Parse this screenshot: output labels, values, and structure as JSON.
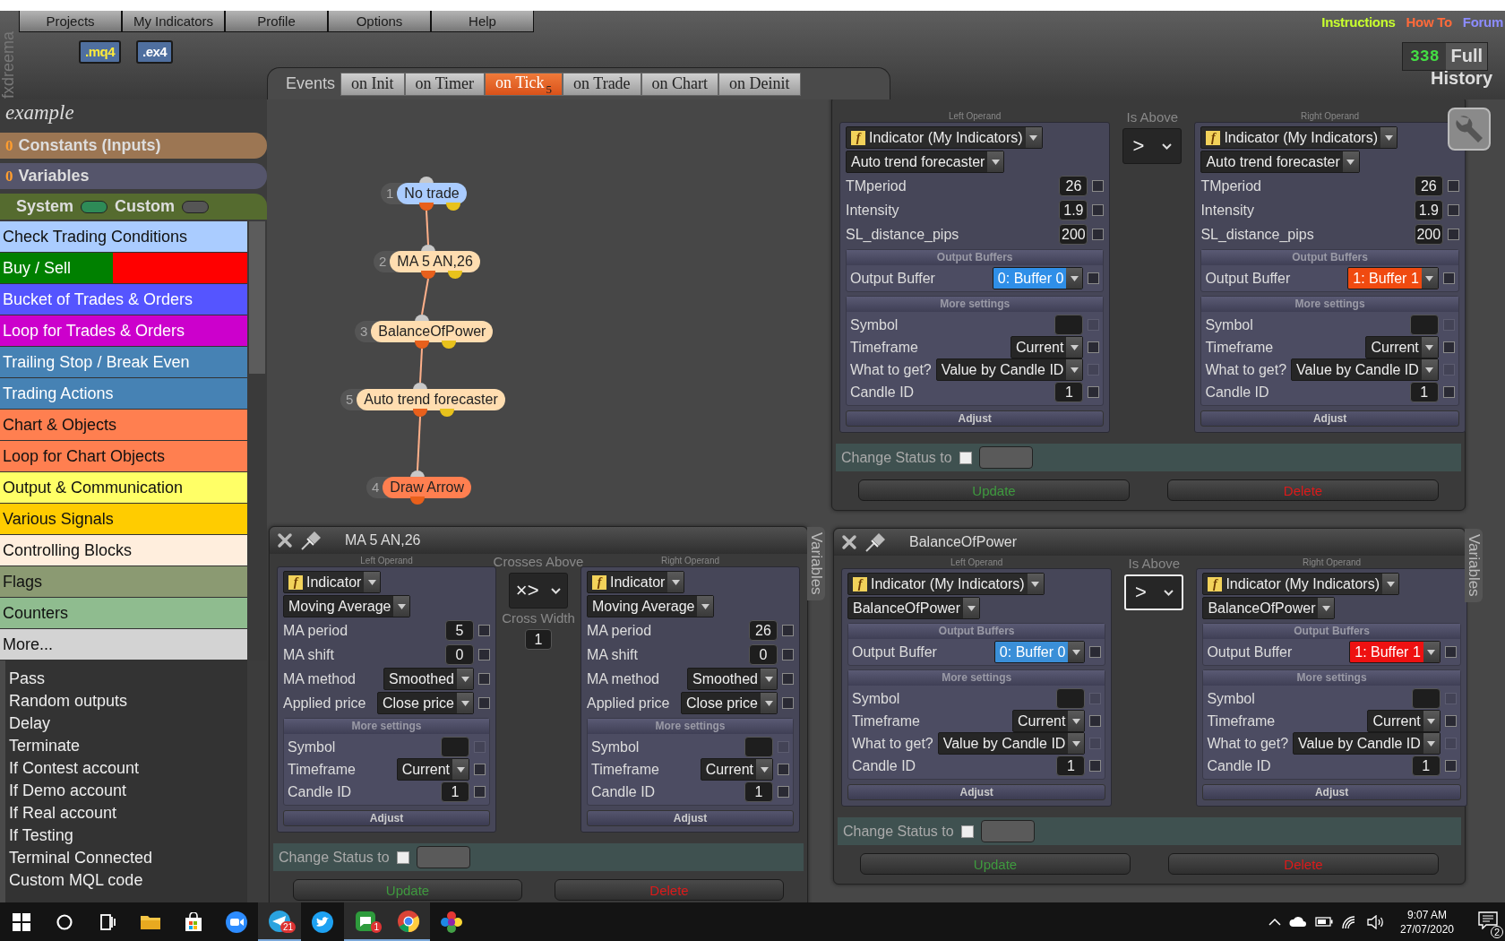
{
  "header": {
    "brand": "fxdreema",
    "menu": [
      {
        "label": "Projects"
      },
      {
        "label": "My Indicators"
      },
      {
        "label": "Profile"
      },
      {
        "label": "Options"
      },
      {
        "label": "Help"
      }
    ],
    "file_buttons": [
      ".mq4",
      ".ex4"
    ],
    "links": [
      {
        "label": "Instructions",
        "color": "#c8ff2e"
      },
      {
        "label": "How To",
        "color": "#ff6a3a"
      },
      {
        "label": "Forum",
        "color": "#8c8cff"
      }
    ],
    "counter": {
      "value": "338",
      "label": "Full"
    },
    "history": "History",
    "events": {
      "label": "Events",
      "tabs": [
        {
          "label": "on Init",
          "selected": false
        },
        {
          "label": "on Timer",
          "selected": false
        },
        {
          "label": "on Tick",
          "badge": "5",
          "selected": true
        },
        {
          "label": "on Trade",
          "selected": false
        },
        {
          "label": "on Chart",
          "selected": false
        },
        {
          "label": "on Deinit",
          "selected": false
        }
      ]
    }
  },
  "sidebar": {
    "project": "example",
    "constants": {
      "count": "0",
      "label": "Constants (Inputs)"
    },
    "variables": {
      "count": "0",
      "label": "Variables"
    },
    "toggles": [
      {
        "label": "System",
        "on": true
      },
      {
        "label": "Custom",
        "on": false
      }
    ],
    "categories": [
      {
        "label": "Check Trading Conditions",
        "color": "#aaccff"
      },
      {
        "label": "Buy / Sell",
        "color": "#008000",
        "split": {
          "color": "#ff0000"
        }
      },
      {
        "label": "Bucket of Trades & Orders",
        "color": "#5555ff"
      },
      {
        "label": "Loop for Trades & Orders",
        "color": "#cc00cc"
      },
      {
        "label": "Trailing Stop / Break Even",
        "color": "#4682b4"
      },
      {
        "label": "Trading Actions",
        "color": "#4682b4"
      },
      {
        "label": "Chart & Objects",
        "color": "#ff7f50"
      },
      {
        "label": "Loop for Chart Objects",
        "color": "#ff7f50"
      },
      {
        "label": "Output & Communication",
        "color": "#ffff66"
      },
      {
        "label": "Various Signals",
        "color": "#ffcc00"
      },
      {
        "label": "Controlling Blocks",
        "color": "#ffeedd"
      },
      {
        "label": "Flags",
        "color": "#8b9a72"
      },
      {
        "label": "Counters",
        "color": "#8fbc8f"
      },
      {
        "label": "More...",
        "color": "#d3d3d3"
      }
    ],
    "more_items": [
      "Pass",
      "Random outputs",
      "Delay",
      "Terminate",
      "If Contest account",
      "If Demo account",
      "If Real account",
      "If Testing",
      "Terminal Connected",
      "Custom MQL code"
    ]
  },
  "nodes": [
    {
      "number": "1",
      "label": "No trade",
      "color": "#aaccff",
      "kind": "condition"
    },
    {
      "number": "2",
      "label": "MA 5 AN,26",
      "color": "#ffddb0",
      "kind": "condition"
    },
    {
      "number": "3",
      "label": "BalanceOfPower",
      "color": "#ffddb0",
      "kind": "condition"
    },
    {
      "number": "5",
      "label": "Auto trend forecaster",
      "color": "#ffddb0",
      "kind": "condition"
    },
    {
      "number": "4",
      "label": "Draw Arrow",
      "color": "#ff7f50",
      "kind": "action"
    }
  ],
  "panels": [
    {
      "left": {
        "header": "Left Operand",
        "type": {
          "icon": "f",
          "label": "Indicator (My Indicators)"
        },
        "indicator": "Auto trend forecaster",
        "params": [
          {
            "label": "TMperiod",
            "value": "26",
            "kind": "number",
            "checked": false,
            "disabled": false
          },
          {
            "label": "Intensity",
            "value": "1.9",
            "kind": "number",
            "checked": false,
            "disabled": false
          },
          {
            "label": "SL_distance_pips",
            "value": "200",
            "kind": "number",
            "checked": false,
            "disabled": false
          }
        ],
        "output": {
          "header": "Output Buffers",
          "label": "Output Buffer",
          "value": "0: Buffer 0",
          "color": "#2f8fe8",
          "checked": false,
          "disabled": false
        },
        "more": {
          "header": "More settings",
          "rows": [
            {
              "label": "Symbol",
              "kind": "number",
              "checked": false,
              "disabled": true
            },
            {
              "label": "Timeframe",
              "value": "Current",
              "kind": "select",
              "checked": false,
              "disabled": false
            },
            {
              "label": "What to get?",
              "value": "Value by Candle ID",
              "kind": "select",
              "checked": false,
              "disabled": true
            },
            {
              "label": "Candle ID",
              "value": "1",
              "kind": "number",
              "checked": false,
              "disabled": false
            }
          ]
        },
        "adjust": "Adjust"
      },
      "operator": {
        "label": "Is Above",
        "symbol": ">",
        "focused": false
      },
      "right": {
        "header": "Right Operand",
        "type": {
          "icon": "f",
          "label": "Indicator (My Indicators)"
        },
        "indicator": "Auto trend forecaster",
        "params": [
          {
            "label": "TMperiod",
            "value": "26",
            "kind": "number",
            "checked": false,
            "disabled": false
          },
          {
            "label": "Intensity",
            "value": "1.9",
            "kind": "number",
            "checked": false,
            "disabled": false
          },
          {
            "label": "SL_distance_pips",
            "value": "200",
            "kind": "number",
            "checked": false,
            "disabled": false
          }
        ],
        "output": {
          "header": "Output Buffers",
          "label": "Output Buffer",
          "value": "1: Buffer 1",
          "color": "#f04a10",
          "checked": false,
          "disabled": false
        },
        "more": {
          "header": "More settings",
          "rows": [
            {
              "label": "Symbol",
              "kind": "number",
              "checked": false,
              "disabled": true
            },
            {
              "label": "Timeframe",
              "value": "Current",
              "kind": "select",
              "checked": false,
              "disabled": false
            },
            {
              "label": "What to get?",
              "value": "Value by Candle ID",
              "kind": "select",
              "checked": false,
              "disabled": true
            },
            {
              "label": "Candle ID",
              "value": "1",
              "kind": "number",
              "checked": false,
              "disabled": false
            }
          ]
        },
        "adjust": "Adjust"
      },
      "status": {
        "label": "Change Status to",
        "checked": false
      },
      "buttons": [
        {
          "label": "Update",
          "kind": "update"
        },
        {
          "label": "Delete",
          "kind": "delete"
        }
      ]
    },
    {
      "title": "MA 5 AN,26",
      "side_tab": "Variables",
      "left": {
        "header": "Left Operand",
        "type": {
          "icon": "f",
          "label": "Indicator"
        },
        "indicator": "Moving Average",
        "params": [
          {
            "label": "MA period",
            "value": "5",
            "kind": "number",
            "checked": false,
            "disabled": false
          },
          {
            "label": "MA shift",
            "value": "0",
            "kind": "number",
            "checked": false,
            "disabled": false
          },
          {
            "label": "MA method",
            "value": "Smoothed",
            "kind": "select",
            "checked": false,
            "disabled": false
          },
          {
            "label": "Applied price",
            "value": "Close price",
            "kind": "select",
            "checked": false,
            "disabled": false
          }
        ],
        "more": {
          "header": "More settings",
          "rows": [
            {
              "label": "Symbol",
              "kind": "number",
              "checked": false,
              "disabled": true
            },
            {
              "label": "Timeframe",
              "value": "Current",
              "kind": "select",
              "checked": false,
              "disabled": false
            },
            {
              "label": "Candle ID",
              "value": "1",
              "kind": "number",
              "checked": false,
              "disabled": false
            }
          ]
        },
        "adjust": "Adjust"
      },
      "operator": {
        "label": "Crosses Above",
        "symbol": "×>",
        "focused": false
      },
      "cross": {
        "label": "Cross Width",
        "value": "1"
      },
      "right": {
        "header": "Right Operand",
        "type": {
          "icon": "f",
          "label": "Indicator"
        },
        "indicator": "Moving Average",
        "params": [
          {
            "label": "MA period",
            "value": "26",
            "kind": "number",
            "checked": false,
            "disabled": false
          },
          {
            "label": "MA shift",
            "value": "0",
            "kind": "number",
            "checked": false,
            "disabled": false
          },
          {
            "label": "MA method",
            "value": "Smoothed",
            "kind": "select",
            "checked": false,
            "disabled": false
          },
          {
            "label": "Applied price",
            "value": "Close price",
            "kind": "select",
            "checked": false,
            "disabled": false
          }
        ],
        "more": {
          "header": "More settings",
          "rows": [
            {
              "label": "Symbol",
              "kind": "number",
              "checked": false,
              "disabled": true
            },
            {
              "label": "Timeframe",
              "value": "Current",
              "kind": "select",
              "checked": false,
              "disabled": false
            },
            {
              "label": "Candle ID",
              "value": "1",
              "kind": "number",
              "checked": false,
              "disabled": false
            }
          ]
        },
        "adjust": "Adjust"
      },
      "status": {
        "label": "Change Status to",
        "checked": false
      },
      "buttons": [
        {
          "label": "Update",
          "kind": "update"
        },
        {
          "label": "Delete",
          "kind": "delete"
        }
      ]
    },
    {
      "title": "BalanceOfPower",
      "side_tab": "Variables",
      "left": {
        "header": "Left Operand",
        "type": {
          "icon": "f",
          "label": "Indicator (My Indicators)"
        },
        "indicator": "BalanceOfPower",
        "output": {
          "header": "Output Buffers",
          "label": "Output Buffer",
          "value": "0: Buffer 0",
          "color": "#3a8fd8",
          "checked": false,
          "disabled": false
        },
        "more": {
          "header": "More settings",
          "rows": [
            {
              "label": "Symbol",
              "kind": "number",
              "checked": false,
              "disabled": true
            },
            {
              "label": "Timeframe",
              "value": "Current",
              "kind": "select",
              "checked": false,
              "disabled": false
            },
            {
              "label": "What to get?",
              "value": "Value by Candle ID",
              "kind": "select",
              "checked": false,
              "disabled": true
            },
            {
              "label": "Candle ID",
              "value": "1",
              "kind": "number",
              "checked": false,
              "disabled": false
            }
          ]
        },
        "adjust": "Adjust"
      },
      "operator": {
        "label": "Is Above",
        "symbol": ">",
        "focused": true
      },
      "right": {
        "header": "Right Operand",
        "type": {
          "icon": "f",
          "label": "Indicator (My Indicators)"
        },
        "indicator": "BalanceOfPower",
        "output": {
          "header": "Output Buffers",
          "label": "Output Buffer",
          "value": "1: Buffer 1",
          "color": "#ee1111",
          "checked": false,
          "disabled": false
        },
        "more": {
          "header": "More settings",
          "rows": [
            {
              "label": "Symbol",
              "kind": "number",
              "checked": false,
              "disabled": true
            },
            {
              "label": "Timeframe",
              "value": "Current",
              "kind": "select",
              "checked": false,
              "disabled": false
            },
            {
              "label": "What to get?",
              "value": "Value by Candle ID",
              "kind": "select",
              "checked": false,
              "disabled": true
            },
            {
              "label": "Candle ID",
              "value": "1",
              "kind": "number",
              "checked": false,
              "disabled": false
            }
          ]
        },
        "adjust": "Adjust"
      },
      "status": {
        "label": "Change Status to",
        "checked": false
      },
      "buttons": [
        {
          "label": "Update",
          "kind": "update"
        },
        {
          "label": "Delete",
          "kind": "delete"
        }
      ]
    }
  ],
  "taskbar": {
    "apps": [
      {
        "kind": "start",
        "active": false
      },
      {
        "kind": "search",
        "active": false
      },
      {
        "kind": "task-view",
        "active": false
      },
      {
        "kind": "folder",
        "active": false
      },
      {
        "kind": "store",
        "active": false
      },
      {
        "kind": "video",
        "active": false
      },
      {
        "kind": "plane",
        "badge": "21",
        "active": true
      },
      {
        "kind": "bird",
        "active": false
      },
      {
        "kind": "chat",
        "badge": "1",
        "active": true
      },
      {
        "kind": "browser",
        "active": true
      },
      {
        "kind": "flower",
        "active": false
      }
    ],
    "time": "9:07 AM",
    "date": "27/07/2020",
    "notifications": "2"
  }
}
